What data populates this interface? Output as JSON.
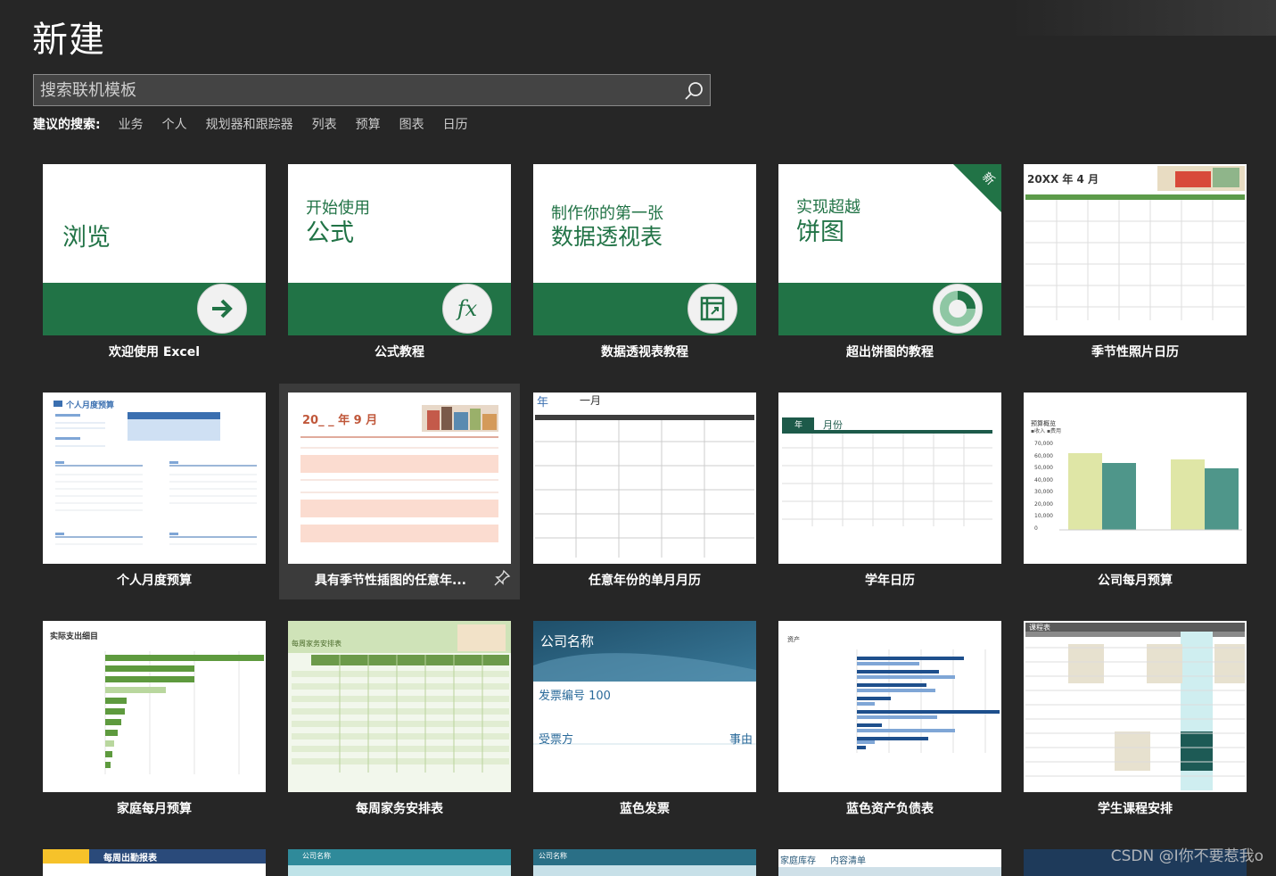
{
  "title": "新建",
  "search": {
    "placeholder": "搜索联机模板"
  },
  "suggested": {
    "label": "建议的搜索:",
    "items": [
      "业务",
      "个人",
      "规划器和跟踪器",
      "列表",
      "预算",
      "图表",
      "日历"
    ]
  },
  "featured": [
    {
      "caption": "欢迎使用 Excel",
      "big": "浏览",
      "small": ""
    },
    {
      "caption": "公式教程",
      "big": "公式",
      "small": "开始使用"
    },
    {
      "caption": "数据透视表教程",
      "big": "数据透视表",
      "small": "制作你的第一张"
    },
    {
      "caption": "超出饼图的教程",
      "big": "饼图",
      "small": "实现超越",
      "tag": "新"
    }
  ],
  "templates": [
    {
      "caption": "季节性照片日历",
      "header": "20XX 年 4 月"
    },
    {
      "caption": "个人月度预算",
      "header": "个人月度预算"
    },
    {
      "caption": "具有季节性插图的任意年...",
      "header": "20_ _ 年 9 月"
    },
    {
      "caption": "任意年份的单月月历",
      "header": "年",
      "header2": "一月"
    },
    {
      "caption": "学年日历",
      "header": "年",
      "header2": "月份"
    },
    {
      "caption": "公司每月预算",
      "header": "预算概览"
    },
    {
      "caption": "家庭每月预算",
      "header": "实际支出细目"
    },
    {
      "caption": "每周家务安排表",
      "header": "每周家务安排表"
    },
    {
      "caption": "蓝色发票",
      "header": "公司名称",
      "line1": "发票编号 100",
      "line2": "受票方",
      "line3": "事由"
    },
    {
      "caption": "蓝色资产负债表",
      "header": "资产"
    },
    {
      "caption": "学生课程安排",
      "header": "课程表"
    }
  ],
  "partial_row": [
    {
      "header": "每周出勤报表"
    },
    {
      "header": "公司名称"
    },
    {
      "header": "公司名称"
    },
    {
      "header": "家庭库存",
      "header2": "内容清单"
    },
    {
      "header": ""
    }
  ],
  "budget_chart": {
    "y_ticks": [
      "70,000",
      "60,000",
      "50,000",
      "40,000",
      "30,000",
      "20,000",
      "10,000",
      "0"
    ],
    "legend": [
      "收入",
      "费用"
    ]
  },
  "watermark": "CSDN @I你不要惹我o",
  "colors": {
    "excel_green": "#217346",
    "background": "#262626"
  }
}
